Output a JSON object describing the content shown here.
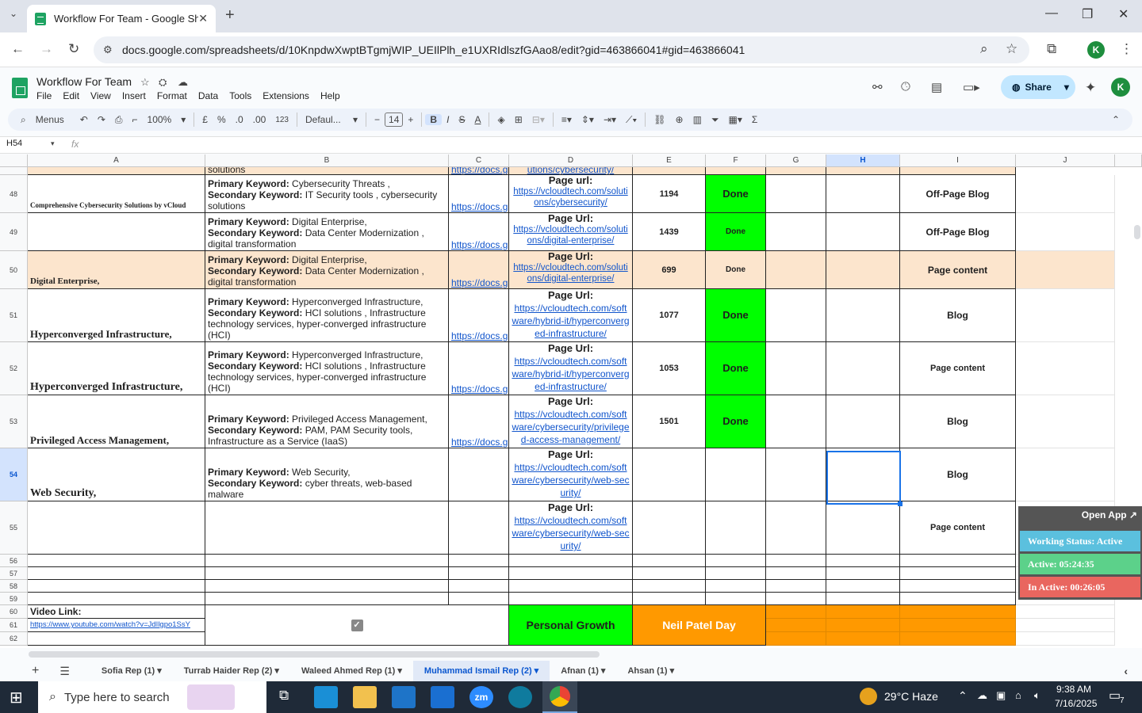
{
  "browser": {
    "tab_title": "Workflow For Team - Google Sh",
    "url": "docs.google.com/spreadsheets/d/10KnpdwXwptBTgmjWIP_UEIlPlh_e1UXRIdlszfGAao8/edit?gid=463866041#gid=463866041",
    "profile_initial": "K"
  },
  "app": {
    "doc_title": "Workflow For Team",
    "menus": [
      "File",
      "Edit",
      "View",
      "Insert",
      "Format",
      "Data",
      "Tools",
      "Extensions",
      "Help"
    ],
    "share_label": "Share",
    "avatar_initial": "K"
  },
  "toolbar": {
    "search_label": "Menus",
    "zoom": "100%",
    "currency": "£",
    "percent": "%",
    "dec_dec": ".0",
    "dec_inc": ".00",
    "num_fmt": "123",
    "font": "Defaul...",
    "font_size": "14",
    "bold": "B",
    "italic": "I",
    "strike": "S",
    "text_color": "A",
    "sigma": "Σ"
  },
  "formula": {
    "name_box": "H54",
    "fx": "fx"
  },
  "columns": [
    "A",
    "B",
    "C",
    "D",
    "E",
    "F",
    "G",
    "H",
    "I",
    "J"
  ],
  "partial_row": {
    "b": "solutions",
    "c": "https://docs.g",
    "d": "utions/cybersecurity/"
  },
  "rows": [
    {
      "num": "48",
      "a": "Comprehensive Cybersecurity Solutions by vCloud",
      "pk": "Cybersecurity Threats ,",
      "sk": " IT Security tools , cybersecurity solutions",
      "c": "https://docs.g",
      "d_title": "Page url:",
      "d_link": "https://vcloudtech.com/solutions/cybersecurity/",
      "e": "1194",
      "f": "Done",
      "i": "Off-Page Blog"
    },
    {
      "num": "49",
      "a": "",
      "pk": "Digital Enterprise,",
      "sk": "Data Center Modernization , digital transformation",
      "c": "https://docs.g",
      "d_title": "Page Url:",
      "d_link": "https://vcloudtech.com/solutions/digital-enterprise/",
      "e": "1439",
      "f": "Done",
      "i": "Off-Page Blog"
    },
    {
      "num": "50",
      "a": "Digital Enterprise,",
      "pk": "Digital Enterprise,",
      "sk": "Data Center Modernization , digital transformation",
      "c": "https://docs.g",
      "d_title": "Page Url:",
      "d_link": "https://vcloudtech.com/solutions/digital-enterprise/",
      "e": "699",
      "f": "Done",
      "i": "Page content"
    },
    {
      "num": "51",
      "a": "Hyperconverged Infrastructure,",
      "pk": "Hyperconverged Infrastructure,",
      "sk": "HCI solutions , Infrastructure technology services, hyper-converged infrastructure (HCI)",
      "c": "https://docs.g",
      "d_title": "Page Url:",
      "d_link": "https://vcloudtech.com/software/hybrid-it/hyperconverged-infrastructure/",
      "e": "1077",
      "f": "Done",
      "i": "Blog"
    },
    {
      "num": "52",
      "a": "Hyperconverged Infrastructure,",
      "pk": "Hyperconverged Infrastructure,",
      "sk": "HCI solutions , Infrastructure technology services, hyper-converged infrastructure (HCI)",
      "c": "https://docs.g",
      "d_title": "Page Url:",
      "d_link": "https://vcloudtech.com/software/hybrid-it/hyperconverged-infrastructure/",
      "e": "1053",
      "f": "Done",
      "i": "Page content"
    },
    {
      "num": "53",
      "a": "Privileged Access Management,",
      "pk": "Privileged Access Management,",
      "sk": "PAM, PAM Security tools, Infrastructure as a Service (IaaS)",
      "c": "https://docs.g",
      "d_title": "Page Url:",
      "d_link": "https://vcloudtech.com/software/cybersecurity/privileged-access-management/",
      "e": "1501",
      "f": "Done",
      "i": "Blog"
    },
    {
      "num": "54",
      "a": "Web Security,",
      "pk": "Web Security,",
      "sk": "cyber threats, web-based malware",
      "c": "",
      "d_title": "Page Url:",
      "d_link": "https://vcloudtech.com/software/cybersecurity/web-security/",
      "e": "",
      "f": "",
      "i": "Blog"
    },
    {
      "num": "55",
      "a": "",
      "pk": "",
      "sk": "",
      "c": "",
      "d_title": "Page Url:",
      "d_link": "https://vcloudtech.com/software/cybersecurity/web-security/",
      "e": "",
      "f": "",
      "i": "Page content"
    }
  ],
  "labels": {
    "pk": "Primary Keyword:",
    "sk": "Secondary Keyword:"
  },
  "empty_rows": [
    "56",
    "57",
    "58",
    "59"
  ],
  "footer": {
    "rows": [
      "60",
      "61",
      "62"
    ],
    "video_label": "Video Link:",
    "video_url": "https://www.youtube.com/watch?v=JdIlgpo1SsY",
    "personal_growth": "Personal Growth",
    "neil_patel": "Neil Patel Day"
  },
  "sheet_tabs": [
    "Sofia Rep (1)",
    "Turrab Haider Rep (2)",
    "Waleed Ahmed Rep (1)",
    "Muhammad Ismail Rep (2)",
    "Afnan (1)",
    "Ahsan (1)"
  ],
  "active_tab_index": 3,
  "widget": {
    "open_app": "Open App ↗",
    "working": "Working Status: Active",
    "active": "Active: 05:24:35",
    "inactive": "In Active: 00:26:05"
  },
  "taskbar": {
    "search_placeholder": "Type here to search",
    "weather": "29°C  Haze",
    "time": "9:38 AM",
    "date": "7/16/2025",
    "notif_count": "7"
  },
  "colors": {
    "done_green": "#00ff00",
    "peach": "#fce5cd",
    "orange": "#ff9900",
    "selection": "#1a73e8"
  }
}
